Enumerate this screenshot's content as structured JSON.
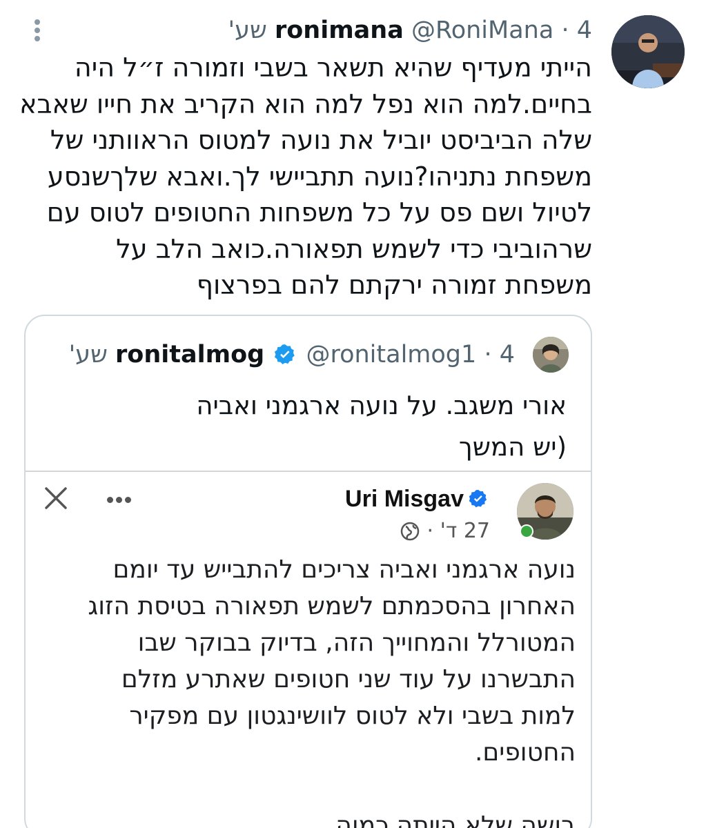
{
  "tweet": {
    "display_name": "ronimana",
    "handle": "@RoniMana",
    "separator": "·",
    "time": "4 שע'",
    "text_lines": [
      "הייתי מעדיף שהיא תשאר בשבי וזמורה ז״ל היה",
      "בחיים.למה הוא נפל למה הוא הקריב את חייו שאבא",
      "שלה הביביסט יוביל את נועה למטוס הראוותני של",
      "משפחת נתניהו?נועה תתביישי לך.ואבא שלךשנסע",
      "לטיול ושם פס על כל משפחות החטופים לטוס עם",
      "שרהוביבי כדי לשמש תפאורה.כואב הלב על",
      "משפחת זמורה ירקתם להם בפרצוף"
    ]
  },
  "quote": {
    "display_name": "ronitalmog",
    "handle": "@ronitalmog1",
    "separator": "·",
    "time": "4 שע'",
    "text_lines": [
      "אורי משגב. על נועה ארגמני ואביה",
      "(יש המשך"
    ]
  },
  "facebook_post": {
    "author": "Uri Misgav",
    "time": "27 ד'",
    "separator": "·",
    "text_lines": [
      "נועה ארגמני ואביה  צריכים להתבייש עד יומם",
      "האחרון בהסכמתם לשמש תפאורה בטיסת הזוג",
      "המטורלל והמחוייך הזה, בדיוק בבוקר שבו",
      "התבשרנו על עוד שני חטופים שאתרע מזלם",
      "למות בשבי ולא לטוס לוושינגטון עם מפקיר",
      "החטופים.",
      "",
      "בושה שלא הייתה כמוה."
    ]
  },
  "icons": {
    "more": "more-vertical-icon",
    "verified": "verified-badge-icon",
    "close": "close-icon",
    "fb_more": "more-horizontal-icon",
    "globe": "globe-icon"
  },
  "colors": {
    "verified": "#1d9bf0",
    "online": "#3aa640",
    "secondary_text": "#536471",
    "card_border": "#cfd9de"
  }
}
